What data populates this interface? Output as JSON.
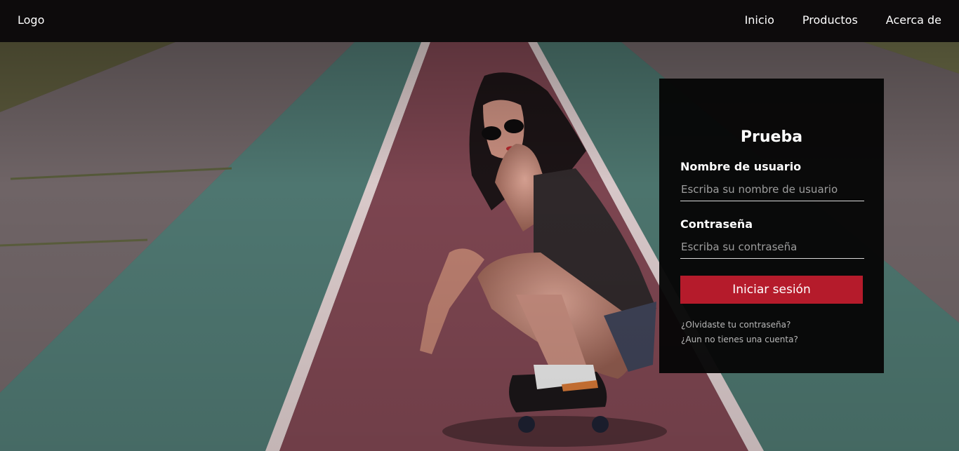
{
  "header": {
    "logo": "Logo",
    "nav": [
      {
        "label": "Inicio"
      },
      {
        "label": "Productos"
      },
      {
        "label": "Acerca de"
      }
    ]
  },
  "login": {
    "title": "Prueba",
    "username_label": "Nombre de usuario",
    "username_placeholder": "Escriba su nombre de usuario",
    "username_value": "",
    "password_label": "Contraseña",
    "password_placeholder": "Escriba su contraseña",
    "password_value": "",
    "submit_label": "Iniciar sesión",
    "forgot_link": "¿Olvidaste tu contraseña?",
    "register_link": "¿Aun no tienes una cuenta?"
  },
  "colors": {
    "header_bg": "#080607",
    "card_bg": "#060606",
    "button": "#b51b2b",
    "track_red": "#7b4650",
    "track_teal": "#4f7a73",
    "track_outer": "#6d6063"
  },
  "background": {
    "description_icon": "roller-skater-photo"
  }
}
